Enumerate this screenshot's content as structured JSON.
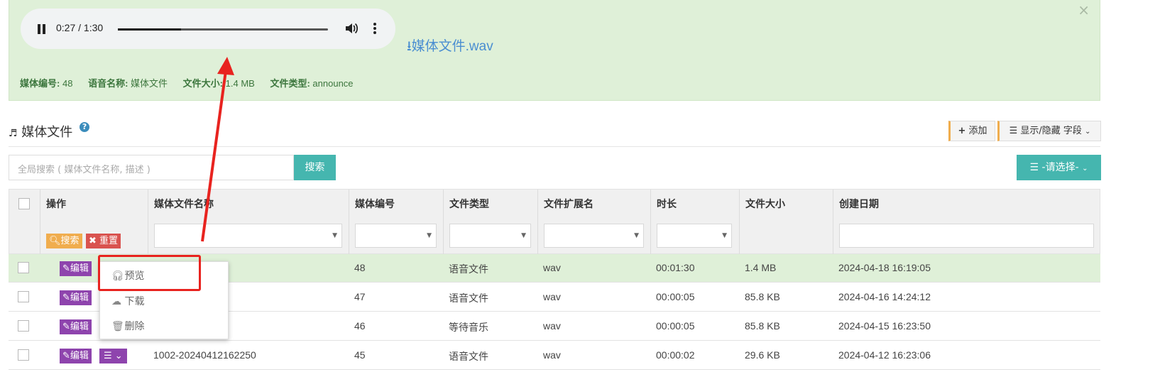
{
  "player": {
    "time": "0:27 / 1:30",
    "progress": 0.3
  },
  "download_link": "⭳媒体文件.wav",
  "meta": [
    {
      "label": "媒体编号:",
      "value": "48"
    },
    {
      "label": "语音名称:",
      "value": "媒体文件"
    },
    {
      "label": "文件大小:",
      "value": "1.4 MB"
    },
    {
      "label": "文件类型:",
      "value": "announce"
    }
  ],
  "section": {
    "title": "媒体文件",
    "help": "?"
  },
  "toolbar": {
    "add": "添加",
    "columns": "显示/隐藏 字段"
  },
  "search": {
    "placeholder": "全局搜索 ( 媒体文件名称, 描述 )",
    "button": "搜索",
    "select": "-请选择-"
  },
  "columns": [
    "操作",
    "媒体文件名称",
    "媒体编号",
    "文件类型",
    "文件扩展名",
    "时长",
    "文件大小",
    "创建日期"
  ],
  "filter_buttons": {
    "search": "搜索",
    "reset": "重置"
  },
  "rows": [
    {
      "name": "",
      "id": "48",
      "type": "语音文件",
      "ext": "wav",
      "duration": "00:01:30",
      "size": "1.4 MB",
      "date": "2024-04-18 16:19:05"
    },
    {
      "name": "",
      "id": "47",
      "type": "语音文件",
      "ext": "wav",
      "duration": "00:00:05",
      "size": "85.8 KB",
      "date": "2024-04-16 14:24:12"
    },
    {
      "name": "",
      "id": "46",
      "type": "等待音乐",
      "ext": "wav",
      "duration": "00:00:05",
      "size": "85.8 KB",
      "date": "2024-04-15 16:23:50"
    },
    {
      "name": "1002-20240412162250",
      "id": "45",
      "type": "语音文件",
      "ext": "wav",
      "duration": "00:00:02",
      "size": "29.6 KB",
      "date": "2024-04-12 16:23:06"
    }
  ],
  "edit_label": "编辑",
  "dropdown": [
    "预览",
    "下载",
    "删除"
  ],
  "colors": {
    "panel_bg": "#dff0d8",
    "teal": "#45b6af",
    "purple": "#8e44ad",
    "orange": "#f0ad4e",
    "red": "#d9534f",
    "highlight_box": "#e8231f"
  }
}
